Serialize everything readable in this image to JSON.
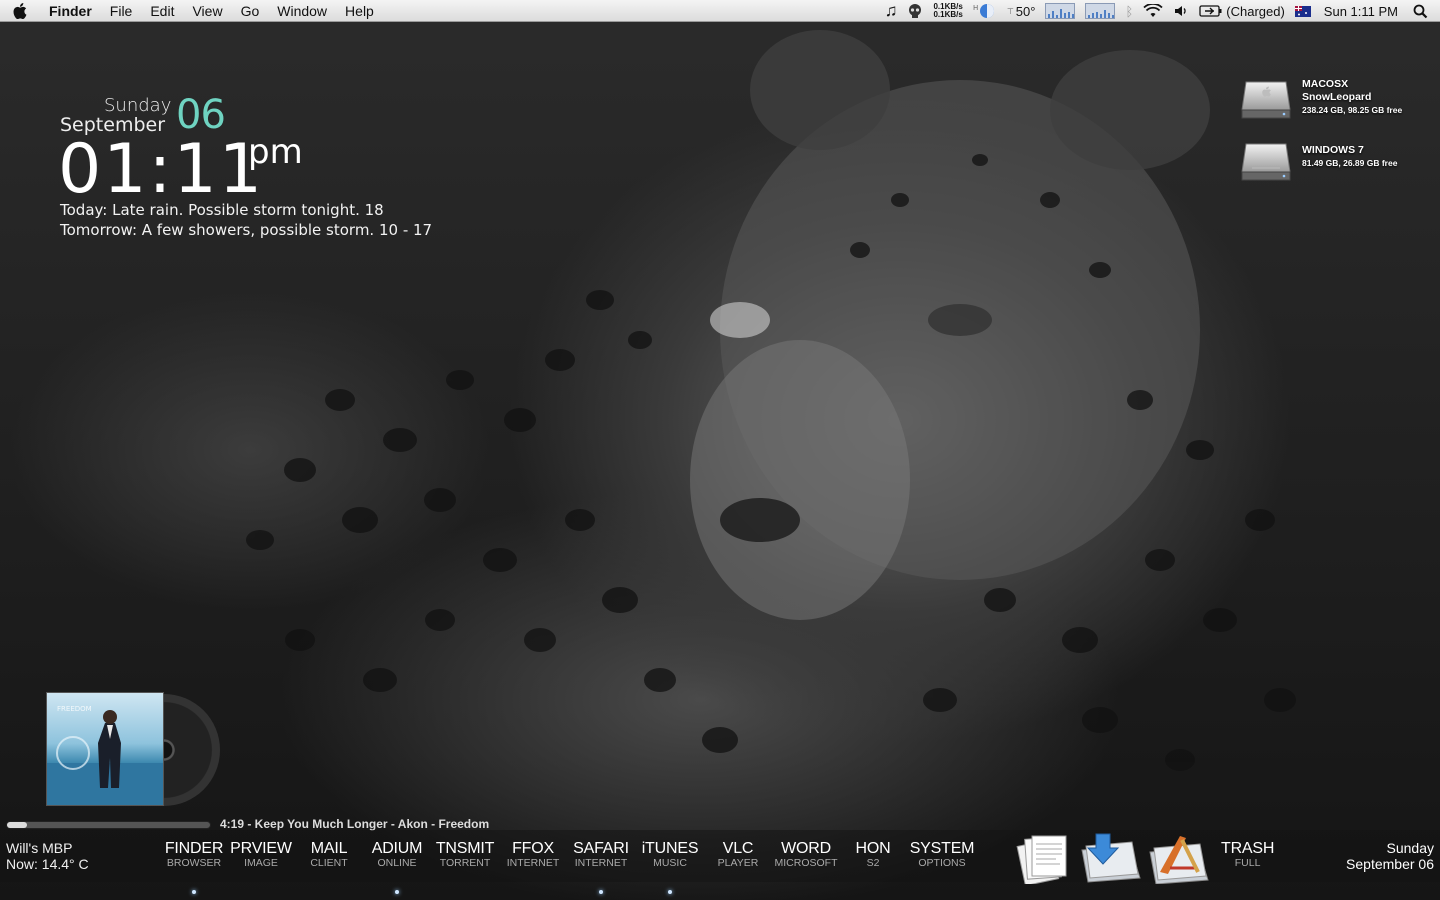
{
  "menubar": {
    "app": "Finder",
    "items": [
      "File",
      "Edit",
      "View",
      "Go",
      "Window",
      "Help"
    ],
    "net_up": "0.1KB/s",
    "net_down": "0.1KB/s",
    "temp": "50°",
    "battery": "(Charged)",
    "clock": "Sun 1:11 PM"
  },
  "clock_widget": {
    "day": "Sunday",
    "month": "September",
    "date": "06",
    "time": "01:11",
    "ampm": "pm",
    "weather_today": "Today: Late rain. Possible storm tonight.  18",
    "weather_tomorrow": "Tomorrow: A few showers, possible storm.  10 - 17"
  },
  "drives": [
    {
      "name1": "MACOSX",
      "name2": "SnowLeopard",
      "size": "238.24 GB, 98.25 GB free",
      "icon": "hard-drive-apple-icon"
    },
    {
      "name1": "WINDOWS 7",
      "name2": "",
      "size": "81.49 GB, 26.89 GB free",
      "icon": "hard-drive-icon"
    }
  ],
  "now_playing": {
    "track": "4:19 - Keep You Much Longer - Akon - Freedom",
    "progress": 0.1
  },
  "status": {
    "host": "Will's MBP",
    "now": "Now: 14.4° C"
  },
  "dock": {
    "items": [
      {
        "label": "FINDER",
        "sub": "BROWSER",
        "running": true
      },
      {
        "label": "PRVIEW",
        "sub": "IMAGE",
        "running": false
      },
      {
        "label": "MAIL",
        "sub": "CLIENT",
        "running": false
      },
      {
        "label": "ADIUM",
        "sub": "ONLINE",
        "running": true
      },
      {
        "label": "TNSMIT",
        "sub": "TORRENT",
        "running": false
      },
      {
        "label": "FFOX",
        "sub": "INTERNET",
        "running": false
      },
      {
        "label": "SAFARI",
        "sub": "INTERNET",
        "running": true
      },
      {
        "label": "iTUNES",
        "sub": "MUSIC",
        "running": true
      },
      {
        "label": "VLC",
        "sub": "PLAYER",
        "running": false
      },
      {
        "label": "WORD",
        "sub": "MICROSOFT",
        "running": false
      },
      {
        "label": "HON",
        "sub": "S2",
        "running": false
      },
      {
        "label": "SYSTEM",
        "sub": "OPTIONS",
        "running": false
      }
    ],
    "stacks": [
      "documents-stack-icon",
      "downloads-stack-icon",
      "applications-stack-icon"
    ],
    "trash": {
      "label": "TRASH",
      "sub": "FULL"
    }
  },
  "date_right": {
    "day": "Sunday",
    "date": "September 06"
  }
}
